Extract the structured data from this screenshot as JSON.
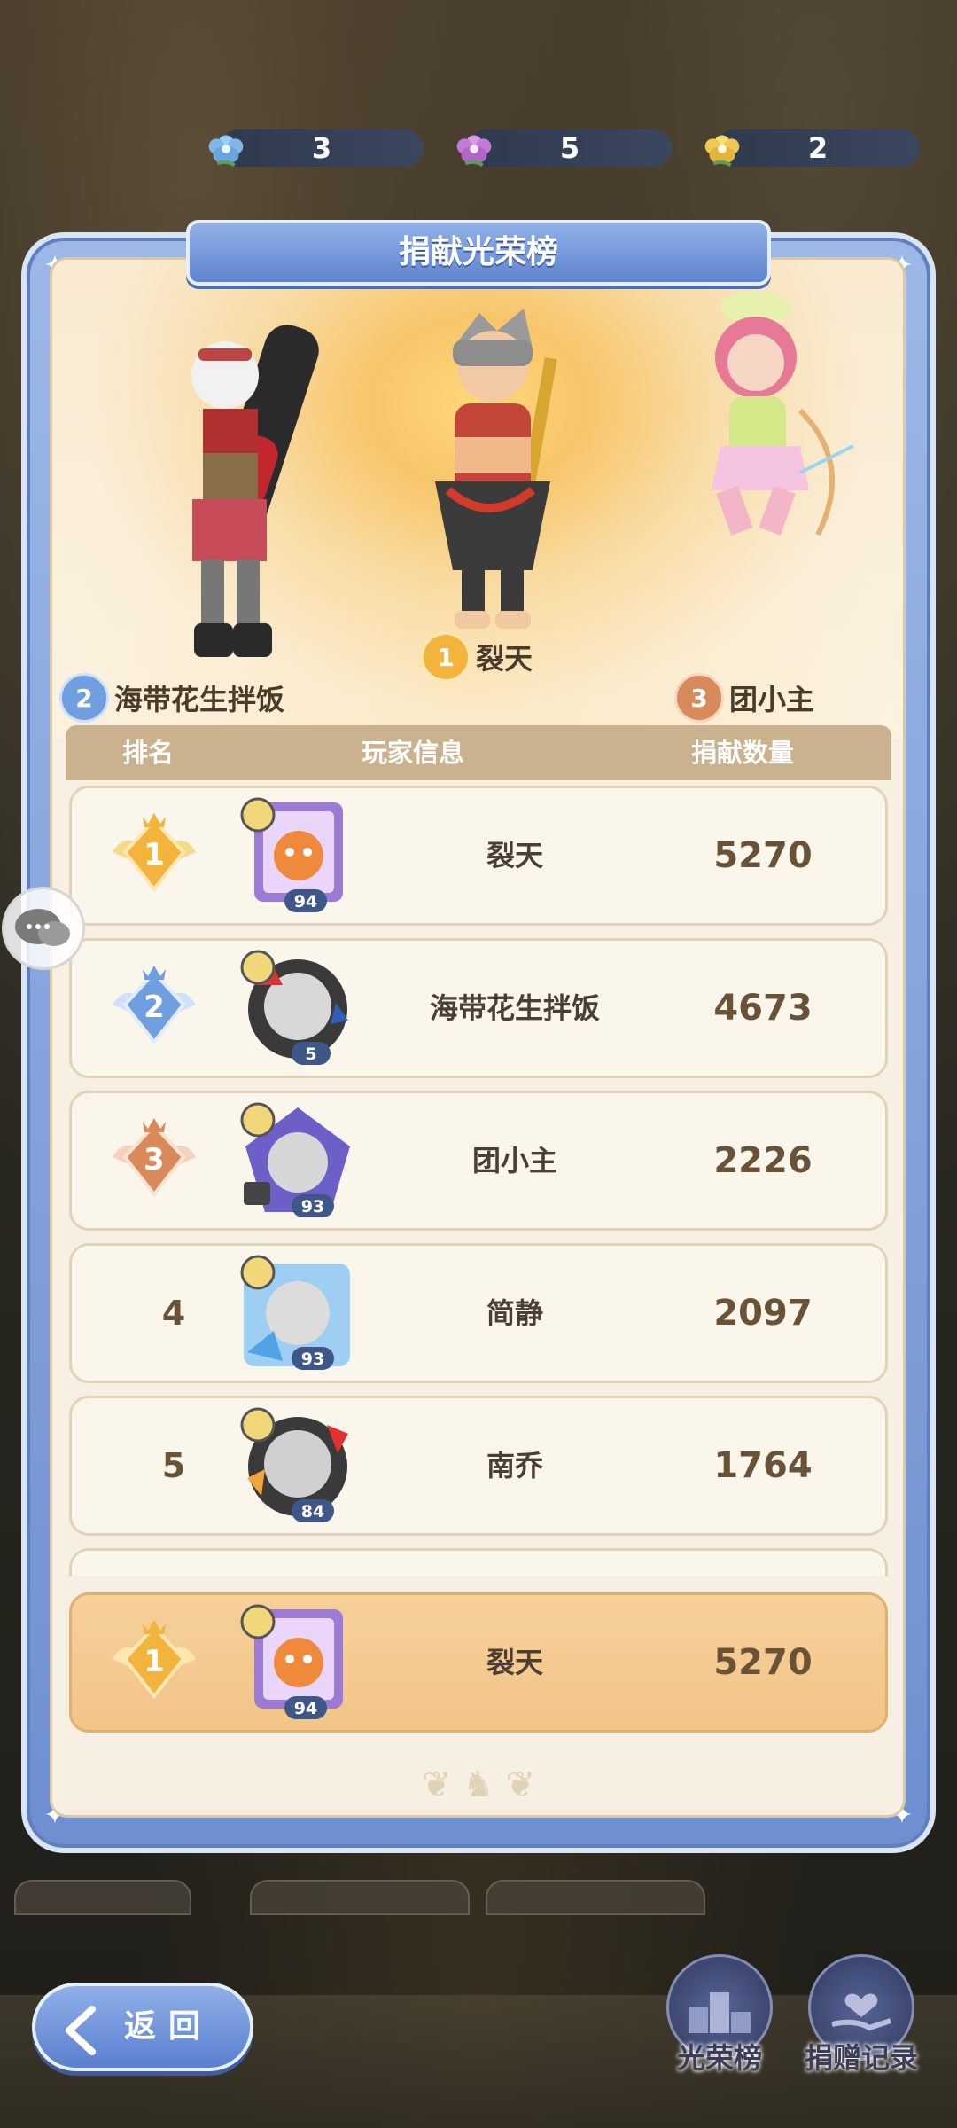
{
  "currencies": [
    {
      "icon": "blue-flower-icon",
      "color": "#7fb8e8",
      "value": "3"
    },
    {
      "icon": "purple-flower-icon",
      "color": "#c37bd8",
      "value": "5"
    },
    {
      "icon": "yellow-flower-icon",
      "color": "#f0c955",
      "value": "2"
    }
  ],
  "panel": {
    "title": "捐献光荣榜"
  },
  "podium": {
    "first": {
      "rank": "1",
      "name": "裂天"
    },
    "second": {
      "rank": "2",
      "name": "海带花生拌饭"
    },
    "third": {
      "rank": "3",
      "name": "团小主"
    }
  },
  "table": {
    "headers": {
      "rank": "排名",
      "player": "玩家信息",
      "amount": "捐献数量"
    },
    "rows": [
      {
        "rank": "1",
        "level": "94",
        "name": "裂天",
        "amount": "5270"
      },
      {
        "rank": "2",
        "level": "5",
        "name": "海带花生拌饭",
        "amount": "4673"
      },
      {
        "rank": "3",
        "level": "93",
        "name": "团小主",
        "amount": "2226"
      },
      {
        "rank": "4",
        "level": "93",
        "name": "简静",
        "amount": "2097"
      },
      {
        "rank": "5",
        "level": "84",
        "name": "南乔",
        "amount": "1764"
      }
    ]
  },
  "self_row": {
    "rank": "1",
    "level": "94",
    "name": "裂天",
    "amount": "5270"
  },
  "buttons": {
    "back": "返回",
    "glory": "光荣榜",
    "donation_record": "捐赠记录"
  },
  "colors": {
    "gold": "#f2b43c",
    "silver_blue": "#6f9fe0",
    "bronze": "#d98a5a"
  }
}
